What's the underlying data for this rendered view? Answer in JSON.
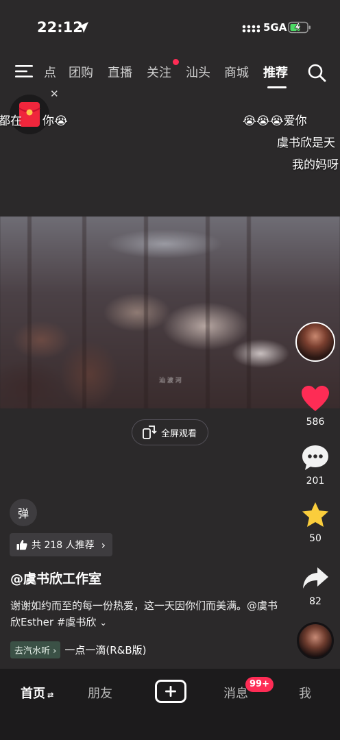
{
  "status_bar": {
    "time": "22:12",
    "network": "5GA"
  },
  "top_nav": {
    "tabs": [
      "点",
      "团购",
      "直播",
      "关注",
      "汕头",
      "商城",
      "推荐"
    ],
    "active_tab": "推荐"
  },
  "danmaku": [
    "都在",
    "你😭",
    "😭😭😭爱你",
    "虞书欣是天",
    "我的妈呀"
  ],
  "video": {
    "watermark": "汕 波 河"
  },
  "fullscreen_label": "全屏观看",
  "actions": {
    "likes": "586",
    "comments": "201",
    "favorites": "50",
    "shares": "82"
  },
  "danmu_toggle": "弹",
  "recommend": {
    "label": "共 218 人推荐"
  },
  "author": "@虞书欣工作室",
  "description": "谢谢如约而至的每一份热爱，这一天因你们而美满。@虞书欣Esther #虞书欣",
  "music": {
    "tag": "去汽水听",
    "name": "一点一滴(R&B版)"
  },
  "bottom_tabs": {
    "home": "首页",
    "friends": "朋友",
    "messages": "消息",
    "messages_badge": "99+",
    "me": "我"
  },
  "colors": {
    "accent": "#fe2c55",
    "like": "#fe2c55",
    "favorite": "#facd3c"
  }
}
